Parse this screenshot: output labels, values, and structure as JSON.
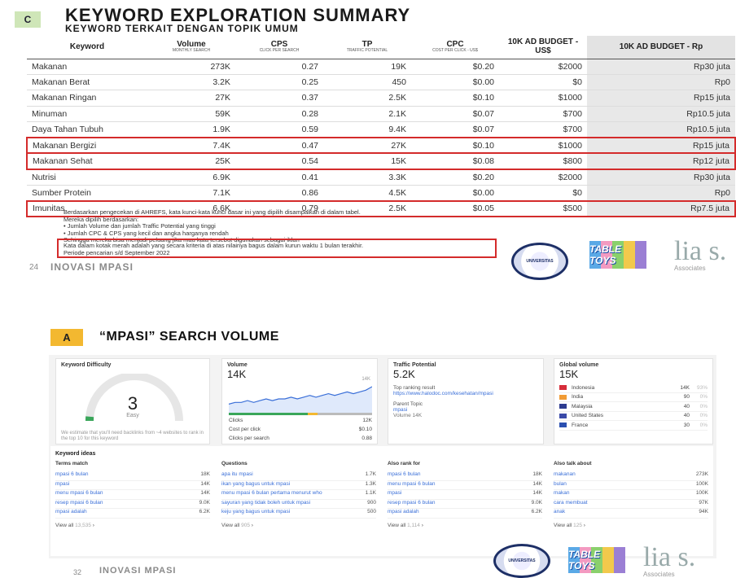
{
  "top": {
    "badge": "C",
    "title": "KEYWORD EXPLORATION SUMMARY",
    "subtitle": "KEYWORD TERKAIT DENGAN TOPIK UMUM",
    "headers": [
      {
        "main": "Keyword",
        "sub": ""
      },
      {
        "main": "Volume",
        "sub": "MONTHLY SEARCH"
      },
      {
        "main": "CPS",
        "sub": "CLICK PER SEARCH"
      },
      {
        "main": "TP",
        "sub": "TRAFFIC POTENTIAL"
      },
      {
        "main": "CPC",
        "sub": "COST PER CLICK - US$"
      },
      {
        "main": "10K AD BUDGET - US$",
        "sub": ""
      },
      {
        "main": "10K AD BUDGET - Rp",
        "sub": ""
      }
    ],
    "rows": [
      {
        "kw": "Makanan",
        "vol": "273K",
        "cps": "0.27",
        "tp": "19K",
        "cpc": "$0.20",
        "usd": "$2000",
        "rp": "Rp30 juta",
        "hl": false
      },
      {
        "kw": "Makanan Berat",
        "vol": "3.2K",
        "cps": "0.25",
        "tp": "450",
        "cpc": "$0.00",
        "usd": "$0",
        "rp": "Rp0",
        "hl": false
      },
      {
        "kw": "Makanan Ringan",
        "vol": "27K",
        "cps": "0.37",
        "tp": "2.5K",
        "cpc": "$0.10",
        "usd": "$1000",
        "rp": "Rp15 juta",
        "hl": false
      },
      {
        "kw": "Minuman",
        "vol": "59K",
        "cps": "0.28",
        "tp": "2.1K",
        "cpc": "$0.07",
        "usd": "$700",
        "rp": "Rp10.5 juta",
        "hl": false
      },
      {
        "kw": "Daya Tahan Tubuh",
        "vol": "1.9K",
        "cps": "0.59",
        "tp": "9.4K",
        "cpc": "$0.07",
        "usd": "$700",
        "rp": "Rp10.5 juta",
        "hl": false
      },
      {
        "kw": "Makanan Bergizi",
        "vol": "7.4K",
        "cps": "0.47",
        "tp": "27K",
        "cpc": "$0.10",
        "usd": "$1000",
        "rp": "Rp15 juta",
        "hl": true
      },
      {
        "kw": "Makanan Sehat",
        "vol": "25K",
        "cps": "0.54",
        "tp": "15K",
        "cpc": "$0.08",
        "usd": "$800",
        "rp": "Rp12 juta",
        "hl": true
      },
      {
        "kw": "Nutrisi",
        "vol": "6.9K",
        "cps": "0.41",
        "tp": "3.3K",
        "cpc": "$0.20",
        "usd": "$2000",
        "rp": "Rp30 juta",
        "hl": false
      },
      {
        "kw": "Sumber Protein",
        "vol": "7.1K",
        "cps": "0.86",
        "tp": "4.5K",
        "cpc": "$0.00",
        "usd": "$0",
        "rp": "Rp0",
        "hl": false
      },
      {
        "kw": "Imunitas",
        "vol": "6.6K",
        "cps": "0.79",
        "tp": "2.5K",
        "cpc": "$0.05",
        "usd": "$500",
        "rp": "Rp7.5 juta",
        "hl": true
      }
    ],
    "notes": [
      "Berdasarkan pengecekan di AHREFS, kata kunci-kata kunci dasar ini yang dipilih disampaikan di dalam tabel.",
      "Mereka dipilih berdasarkan:",
      "• Jumlah Volume dan jumlah Traffic Potential yang tinggi",
      "• Jumlah CPC & CPS yang kecil dan angka harganya rendah",
      "Sehingga mereka bisa menjadi peluang jika mau kata tersebut digunakan sebagai iklan"
    ],
    "redbox": [
      "Kata dalam kotak merah adalah yang secara kriteria di atas nilainya bagus dalam kurun waktu 1 bulan terakhir.",
      "Periode pencarian s/d September 2022"
    ],
    "page_number": "24",
    "footer": "INOVASI MPASI"
  },
  "logos": {
    "tabletoys": "TABLE TOYS",
    "lia": "lia s.",
    "lia_sub": "Associates",
    "seal": "UNIVERSITAS"
  },
  "bottom": {
    "badge": "A",
    "title": "“MPASI” SEARCH VOLUME",
    "kd": {
      "label": "Keyword Difficulty",
      "value": "3",
      "level": "Easy",
      "note": "We estimate that you'll need backlinks from ~4 websites to rank in the top 10 for this keyword",
      "gauge_fraction": 0.03
    },
    "volume": {
      "label": "Volume",
      "value": "14K",
      "ymax": "14K",
      "clicks_label": "Clicks",
      "clicks": "12K",
      "cpc_label": "Cost per click",
      "cpc": "$0.10",
      "cps_label": "Clicks per search",
      "cps": "0.88",
      "trend": [
        4,
        5,
        5,
        6,
        5,
        6,
        7,
        6,
        7,
        7,
        8,
        7,
        8,
        9,
        8,
        9,
        10,
        9,
        10,
        11,
        10,
        11,
        12,
        14
      ]
    },
    "tp": {
      "label": "Traffic Potential",
      "value": "5.2K",
      "top_label": "Top ranking result",
      "top_url": "https://www.halodoc.com/kesehatan/mpasi",
      "parent_label": "Parent Topic",
      "parent": "mpasi",
      "parent_vol": "Volume 14K"
    },
    "global": {
      "label": "Global volume",
      "value": "15K",
      "countries": [
        {
          "name": "Indonesia",
          "vol": "14K",
          "pct": "93%",
          "color": "#d62d3a"
        },
        {
          "name": "India",
          "vol": "90",
          "pct": "0%",
          "color": "#f19b35"
        },
        {
          "name": "Malaysia",
          "vol": "40",
          "pct": "0%",
          "color": "#2d3b8f"
        },
        {
          "name": "United States",
          "vol": "40",
          "pct": "0%",
          "color": "#3b4aa8"
        },
        {
          "name": "France",
          "vol": "30",
          "pct": "0%",
          "color": "#2a4fb0"
        }
      ]
    },
    "ideas_title": "Keyword ideas",
    "terms": {
      "h": "Terms match",
      "rows": [
        [
          "mpasi 6 bulan",
          "18K"
        ],
        [
          "mpasi",
          "14K"
        ],
        [
          "menu mpasi 6 bulan",
          "14K"
        ],
        [
          "resep mpasi 6 bulan",
          "9.0K"
        ],
        [
          "mpasi adalah",
          "6.2K"
        ]
      ],
      "viewall": "View all",
      "count": "13,535"
    },
    "questions": {
      "h": "Questions",
      "rows": [
        [
          "apa itu mpasi",
          "1.7K"
        ],
        [
          "ikan yang bagus untuk mpasi",
          "1.3K"
        ],
        [
          "menu mpasi 6 bulan pertama menurut who",
          "1.1K"
        ],
        [
          "sayuran yang tidak boleh untuk mpasi",
          "900"
        ],
        [
          "keju yang bagus untuk mpasi",
          "500"
        ]
      ],
      "viewall": "View all",
      "count": "905"
    },
    "rank": {
      "h": "Also rank for",
      "rows": [
        [
          "mpasi 6 bulan",
          "18K"
        ],
        [
          "menu mpasi 6 bulan",
          "14K"
        ],
        [
          "mpasi",
          "14K"
        ],
        [
          "resep mpasi 6 bulan",
          "9.0K"
        ],
        [
          "mpasi adalah",
          "6.2K"
        ]
      ],
      "viewall": "View all",
      "count": "1,114"
    },
    "talk": {
      "h": "Also talk about",
      "rows": [
        [
          "makanan",
          "273K"
        ],
        [
          "bulan",
          "100K"
        ],
        [
          "makan",
          "100K"
        ],
        [
          "cara membuat",
          "97K"
        ],
        [
          "anak",
          "94K"
        ]
      ],
      "viewall": "View all",
      "count": "125"
    },
    "page_number": "32",
    "footer": "INOVASI MPASI"
  }
}
